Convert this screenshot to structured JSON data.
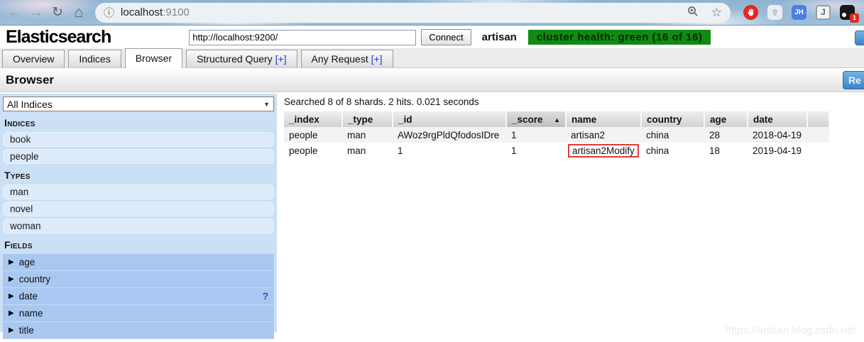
{
  "chrome": {
    "url_host": "localhost",
    "url_port": ":9100",
    "ext_jh_label": "JH",
    "ext_j_label": "J",
    "ext_badge_count": "1"
  },
  "header": {
    "app_title": "Elasticsearch",
    "endpoint_value": "http://localhost:9200/",
    "connect_label": "Connect",
    "cluster_name": "artisan",
    "cluster_health_label": "cluster health: green (16 of 16)"
  },
  "tabs": {
    "overview": "Overview",
    "indices": "Indices",
    "browser": "Browser",
    "structured_query": "Structured Query",
    "any_request": "Any Request",
    "plus": "[+]"
  },
  "browser_panel": {
    "title": "Browser",
    "refresh_label_visible": "Re"
  },
  "sidebar": {
    "filter_selected": "All Indices",
    "indices_header": "Indices",
    "indices": [
      "book",
      "people"
    ],
    "types_header": "Types",
    "types": [
      "man",
      "novel",
      "woman"
    ],
    "fields_header": "Fields",
    "fields": [
      "age",
      "country",
      "date",
      "name",
      "title"
    ],
    "date_help": "?"
  },
  "results": {
    "summary": "Searched 8 of 8 shards. 2 hits. 0.021 seconds",
    "columns": {
      "index": "_index",
      "type": "_type",
      "id": "_id",
      "score": "_score",
      "name": "name",
      "country": "country",
      "age": "age",
      "date": "date"
    },
    "rows": [
      {
        "index": "people",
        "type": "man",
        "id": "AWoz9rgPldQfodosIDre",
        "score": "1",
        "name": "artisan2",
        "country": "china",
        "age": "28",
        "date": "2018-04-19"
      },
      {
        "index": "people",
        "type": "man",
        "id": "1",
        "score": "1",
        "name": "artisan2Modify",
        "country": "china",
        "age": "18",
        "date": "2019-04-19"
      }
    ]
  },
  "watermark": "https://artisan.blog.csdn.net",
  "icons": {
    "back": "←",
    "forward": "→",
    "refresh": "↻",
    "home": "⌂",
    "info": "ⓘ",
    "star": "☆",
    "sort_asc": "▲",
    "expand": "▶",
    "dropdown": "▼"
  },
  "colors": {
    "health_green": "#128a12",
    "accent_blue": "#3c84c9",
    "annotation_red": "#e23b3b"
  }
}
